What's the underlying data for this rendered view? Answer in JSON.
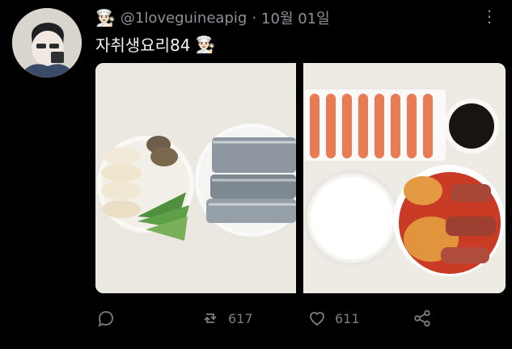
{
  "post": {
    "handle": "@1loveguineapig",
    "separator": "·",
    "date": "10월 01일",
    "text": "자취생요리84",
    "emoji": "👨🏻‍🍳",
    "more": "⋮"
  },
  "actions": {
    "reply_count": "",
    "retweet_count": "617",
    "like_count": "611"
  },
  "icons": {
    "reply": "reply-icon",
    "retweet": "retweet-icon",
    "like": "heart-icon",
    "share": "share-icon",
    "more": "more-icon"
  }
}
